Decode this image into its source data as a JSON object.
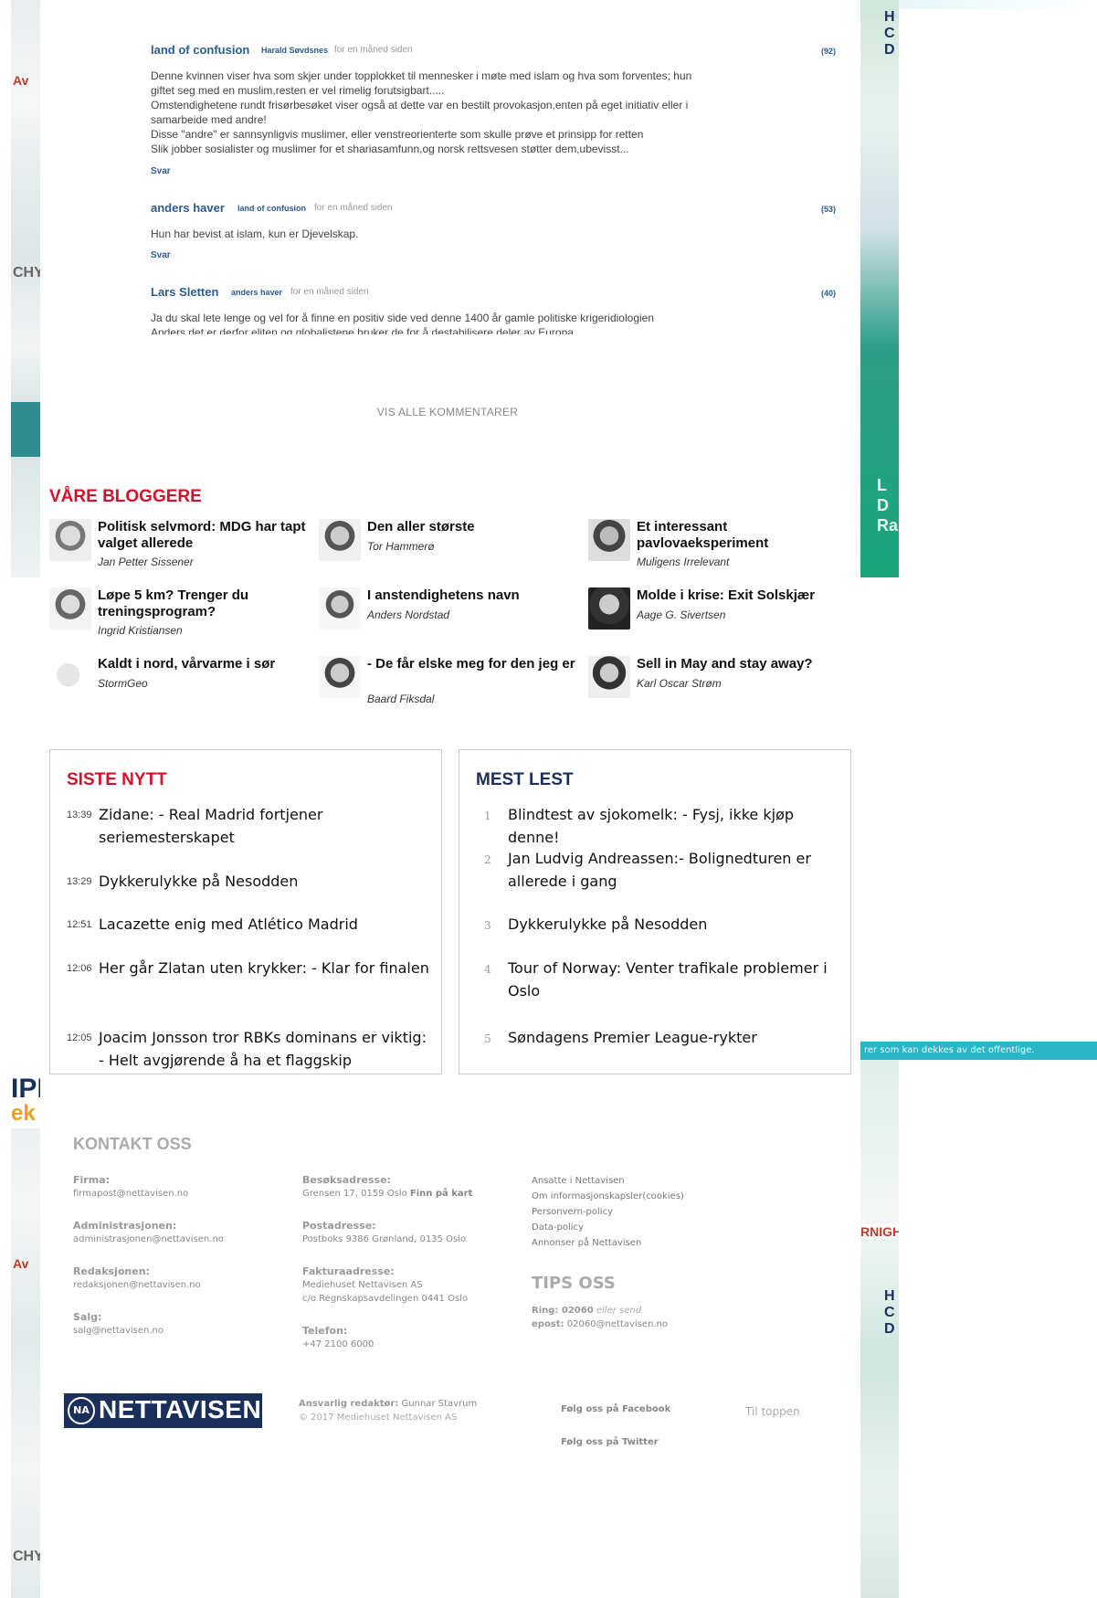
{
  "ads": {
    "banner_text": "rer som kan dekkes av det offentlige."
  },
  "comments": [
    {
      "author": "land of confusion",
      "reply_to": "Harald Søvdsnes",
      "time": "for en måned siden",
      "count": "(92)",
      "lines": [
        "Denne kvinnen viser hva som skjer under topplokket til mennesker i møte med islam og hva som forventes; hun",
        "giftet seg med en muslim,resten er vel rimelig forutsigbart.....",
        "Omstendighetene rundt frisørbesøket viser også at dette var en bestilt provokasjon,enten på eget initiativ eller i",
        "samarbeide med andre!",
        "Disse \"andre\" er sannsynligvis muslimer, eller venstreorienterte som skulle prøve et prinsipp for retten",
        "Slik jobber sosialister og muslimer for et shariasamfunn,og norsk rettsvesen støtter dem,ubevisst..."
      ],
      "reply_label": "Svar"
    },
    {
      "author": "anders haver",
      "reply_to": "land of confusion",
      "time": "for en måned siden",
      "count": "(53)",
      "lines": [
        "Hun har bevist at islam, kun er Djevelskap."
      ],
      "reply_label": "Svar"
    },
    {
      "author": "Lars Sletten",
      "reply_to": "anders haver",
      "time": "for en måned siden",
      "count": "(40)",
      "lines": [
        "Ja du skal lete lenge og vel for å finne en positiv side ved denne 1400 år gamle politiske krigeridiologien",
        "Anders det er derfor eliten og globalistene bruker de for å destabilisere deler av Europa"
      ]
    }
  ],
  "show_all_comments": "VIS ALLE KOMMENTARER",
  "bloggers": {
    "title": "VÅRE BLOGGERE",
    "items": [
      {
        "headline": "Politisk selvmord: MDG har tapt valget allerede",
        "author": "Jan Petter Sissener"
      },
      {
        "headline": "Den aller største",
        "author": "Tor Hammerø"
      },
      {
        "headline": "Et interessant pavlovaeksperiment",
        "author": "Muligens Irrelevant"
      },
      {
        "headline": "Løpe 5 km? Trenger du treningsprogram?",
        "author": "Ingrid Kristiansen"
      },
      {
        "headline": "I anstendighetens navn",
        "author": "Anders Nordstad"
      },
      {
        "headline": "Molde i krise: Exit Solskjær",
        "author": "Aage G. Sivertsen"
      },
      {
        "headline": "Kaldt i nord, vårvarme i sør",
        "author": "StormGeo"
      },
      {
        "headline": "- De får elske meg for den jeg er",
        "author": "Baard Fiksdal"
      },
      {
        "headline": "Sell in May and stay away?",
        "author": "Karl Oscar Strøm"
      }
    ]
  },
  "siste_nytt": {
    "title": "SISTE NYTT",
    "items": [
      {
        "time": "13:39",
        "text": "Zidane: - Real Madrid fortjener seriemesterskapet"
      },
      {
        "time": "13:29",
        "text": "Dykkerulykke på Nesodden"
      },
      {
        "time": "12:51",
        "text": "Lacazette enig med Atlético Madrid"
      },
      {
        "time": "12:06",
        "text": "Her går Zlatan uten krykker: - Klar for finalen"
      },
      {
        "time": "12:05",
        "text": "Joacim Jonsson tror RBKs dominans er viktig: - Helt avgjørende å ha et flaggskip"
      }
    ]
  },
  "mest_lest": {
    "title": "MEST LEST",
    "items": [
      {
        "rank": "1",
        "text": "Blindtest av sjokomelk:  - Fysj, ikke kjøp denne!"
      },
      {
        "rank": "2",
        "text": "Jan Ludvig Andreassen:- Bolignedturen er allerede i gang"
      },
      {
        "rank": "3",
        "text": "Dykkerulykke på Nesodden"
      },
      {
        "rank": "4",
        "text": "Tour of Norway: Venter trafikale problemer i Oslo"
      },
      {
        "rank": "5",
        "text": "Søndagens Premier League-rykter"
      }
    ]
  },
  "footer": {
    "contact_title": "KONTAKT OSS",
    "contacts": [
      {
        "label": "Firma:",
        "value": "firmapost@nettavisen.no"
      },
      {
        "label": "Administrasjonen:",
        "value": "administrasjonen@nettavisen.no"
      },
      {
        "label": "Redaksjonen:",
        "value": "redaksjonen@nettavisen.no"
      },
      {
        "label": "Salg:",
        "value": "salg@nettavisen.no"
      }
    ],
    "addresses": [
      {
        "label": "Besøksadresse:",
        "value": "Grensen 17, 0159 Oslo",
        "extra": "Finn på kart"
      },
      {
        "label": "Postadresse:",
        "value": "Postboks 9386 Grønland, 0135 Oslo"
      },
      {
        "label": "Fakturaadresse:",
        "value": "Mediehuset Nettavisen AS",
        "value2": "c/o Regnskapsavdelingen 0441 Oslo"
      },
      {
        "label": "Telefon:",
        "value": "+47 2100 6000"
      }
    ],
    "links": [
      "Ansatte i Nettavisen",
      "Om informasjonskapsler(cookies)",
      "Personvern-policy",
      "Data-policy",
      "Annonser på Nettavisen"
    ],
    "tips_title": "TIPS OSS",
    "tips_ring_label": "Ring: 02060",
    "tips_ring_suffix": "eller send",
    "tips_epost_label": "epost:",
    "tips_epost_value": "02060@nettavisen.no",
    "logo_badge": "NA",
    "logo_text": "NETTAVISEN",
    "editor_label": "Ansvarlig redaktør:",
    "editor_name": "Gunnar Stavrum",
    "copyright": "© 2017 Mediehuset Nettavisen AS",
    "facebook": "Følg oss på Facebook",
    "twitter": "Følg oss på Twitter",
    "to_top": "Til toppen"
  }
}
